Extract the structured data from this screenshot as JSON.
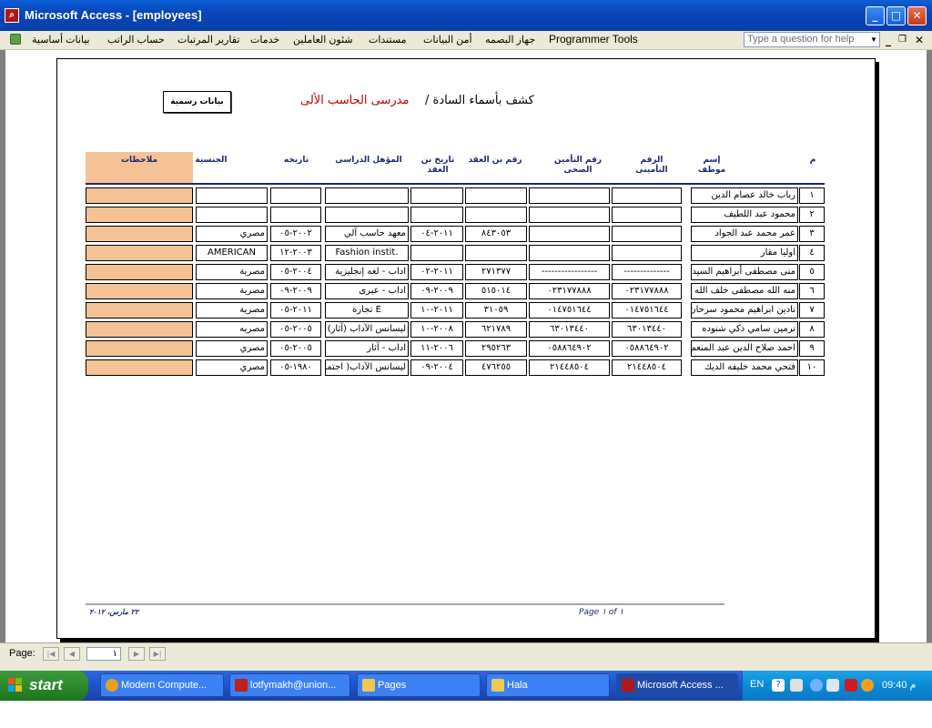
{
  "window": {
    "title": "Microsoft Access - [employees]"
  },
  "menu": {
    "items": [
      "بيانات أساسية",
      "حساب الراتب",
      "تقارير المرتبات",
      "خدمات",
      "شئون العاملين",
      "مستندات",
      "أمن البيانات",
      "جهاز البصمه",
      "Programmer Tools"
    ],
    "help_placeholder": "Type a question for help"
  },
  "report": {
    "button_label": "بيانات رسمية",
    "title_prefix": "كشف بأسماء السادة /",
    "title_highlight": "مدرسى الحاسب الألى",
    "headers": {
      "num": "م",
      "name": "إسم موظف",
      "insurance_no": "الرقم التأمينى",
      "health_no": "رقم التأمين الصحى",
      "contract_no": "رقم بن العقد",
      "contract_date": "تاريخ بن العقد",
      "qualification": "المؤهل الدراسى",
      "date": "تاريخه",
      "nationality": "الجنسية",
      "notes": "ملاحظات"
    },
    "rows": [
      {
        "num": "١",
        "name": "رباب خالد عصام الدين",
        "ins": "",
        "health": "",
        "contract": "",
        "cdate": "",
        "qual": "",
        "date": "",
        "nat": ""
      },
      {
        "num": "٢",
        "name": "محمود عبد اللطيف",
        "ins": "",
        "health": "",
        "contract": "",
        "cdate": "",
        "qual": "",
        "date": "",
        "nat": ""
      },
      {
        "num": "٣",
        "name": "عمر محمد عبد الجواد",
        "ins": "",
        "health": "",
        "contract": "٨٤٣٠٥٣",
        "cdate": "٢٠١١-٠٤",
        "qual": "معهد حاسب آلي",
        "date": "٢٠٠٢-٠٥",
        "nat": "مصري"
      },
      {
        "num": "٤",
        "name": "اوليا مقار",
        "ins": "",
        "health": "",
        "contract": "",
        "cdate": "",
        "qual": "Fashion instit.",
        "date": "٢٠٠٣-١٢",
        "nat": "AMERICAN"
      },
      {
        "num": "٥",
        "name": "منى مصطفى أبراهيم السيد",
        "ins": "--------------",
        "health": "-----------------",
        "contract": "٢٧١٣٧٧",
        "cdate": "٢٠١١-٠٢",
        "qual": "اداب - لغه إنجليزية",
        "date": "٢٠٠٤-٠٥",
        "nat": "مصرية"
      },
      {
        "num": "٦",
        "name": "منه الله مصطفى خلف الله",
        "ins": "٠٢٣١٧٧٨٨٨",
        "health": "٠٢٣١٧٧٨٨٨",
        "contract": "٥١٥٠١٤",
        "cdate": "٢٠٠٩-٠٩",
        "qual": "اداب - عبرى",
        "date": "٢٠٠٩-٠٩",
        "nat": "مصرية"
      },
      {
        "num": "٧",
        "name": "نادين ابراهيم محمود سرحان",
        "ins": "٠١٤٧٥١٦٤٤",
        "health": "٠١٤٧٥١٦٤٤",
        "contract": "٣١٠٥٩",
        "cdate": "٢٠١١-١٠",
        "qual": "تجارة E",
        "date": "٢٠١١-٠٥",
        "nat": "مصرية"
      },
      {
        "num": "٨",
        "name": "نرمين سامي ذكي شنوده",
        "ins": "٦٣٠١٣٤٤٠",
        "health": "٦٣٠١٣٤٤٠",
        "contract": "٦٢١٧٨٩",
        "cdate": "٢٠٠٨-١٠",
        "qual": "ليسانس الآداب (آثار)",
        "date": "٢٠٠٥-٠٥",
        "nat": "مصريه"
      },
      {
        "num": "٩",
        "name": "احمد صلاح الدين عبد المنعم",
        "ins": "٠٥٨٨٦٤٩٠٢",
        "health": "٠٥٨٨٦٤٩٠٢",
        "contract": "٢٩٥٢٦٣",
        "cdate": "٢٠٠٦-١١",
        "qual": "اداب - آثار",
        "date": "٢٠٠٥-٠٥",
        "nat": "مصري"
      },
      {
        "num": "١٠",
        "name": "فتحي محمد خليفه الديك",
        "ins": "٢١٤٤٨٥٠٤",
        "health": "٢١٤٤٨٥٠٤",
        "contract": "٤٧٦٢٥٥",
        "cdate": "٢٠٠٤-٠٩",
        "qual": "ليسانس الآداب( اجتماع)",
        "date": "١٩٨٠-٠٥",
        "nat": "مصري"
      }
    ],
    "footer_date": "٢٢ مارس، ٢٠١٢",
    "footer_page": "Page ١ of ١"
  },
  "nav": {
    "label": "Page:",
    "current": "١"
  },
  "taskbar": {
    "start": "start",
    "tasks": [
      {
        "label": "Modern Compute...",
        "color": "#e8a020"
      },
      {
        "label": "lotfymakh@union...",
        "color": "#c0201a"
      },
      {
        "label": "Pages",
        "color": "#f0c850"
      },
      {
        "label": "Hala",
        "color": "#f0c850"
      },
      {
        "label": "Microsoft Access ...",
        "color": "#b01818"
      }
    ],
    "lang": "EN",
    "clock": "09:40 م"
  }
}
